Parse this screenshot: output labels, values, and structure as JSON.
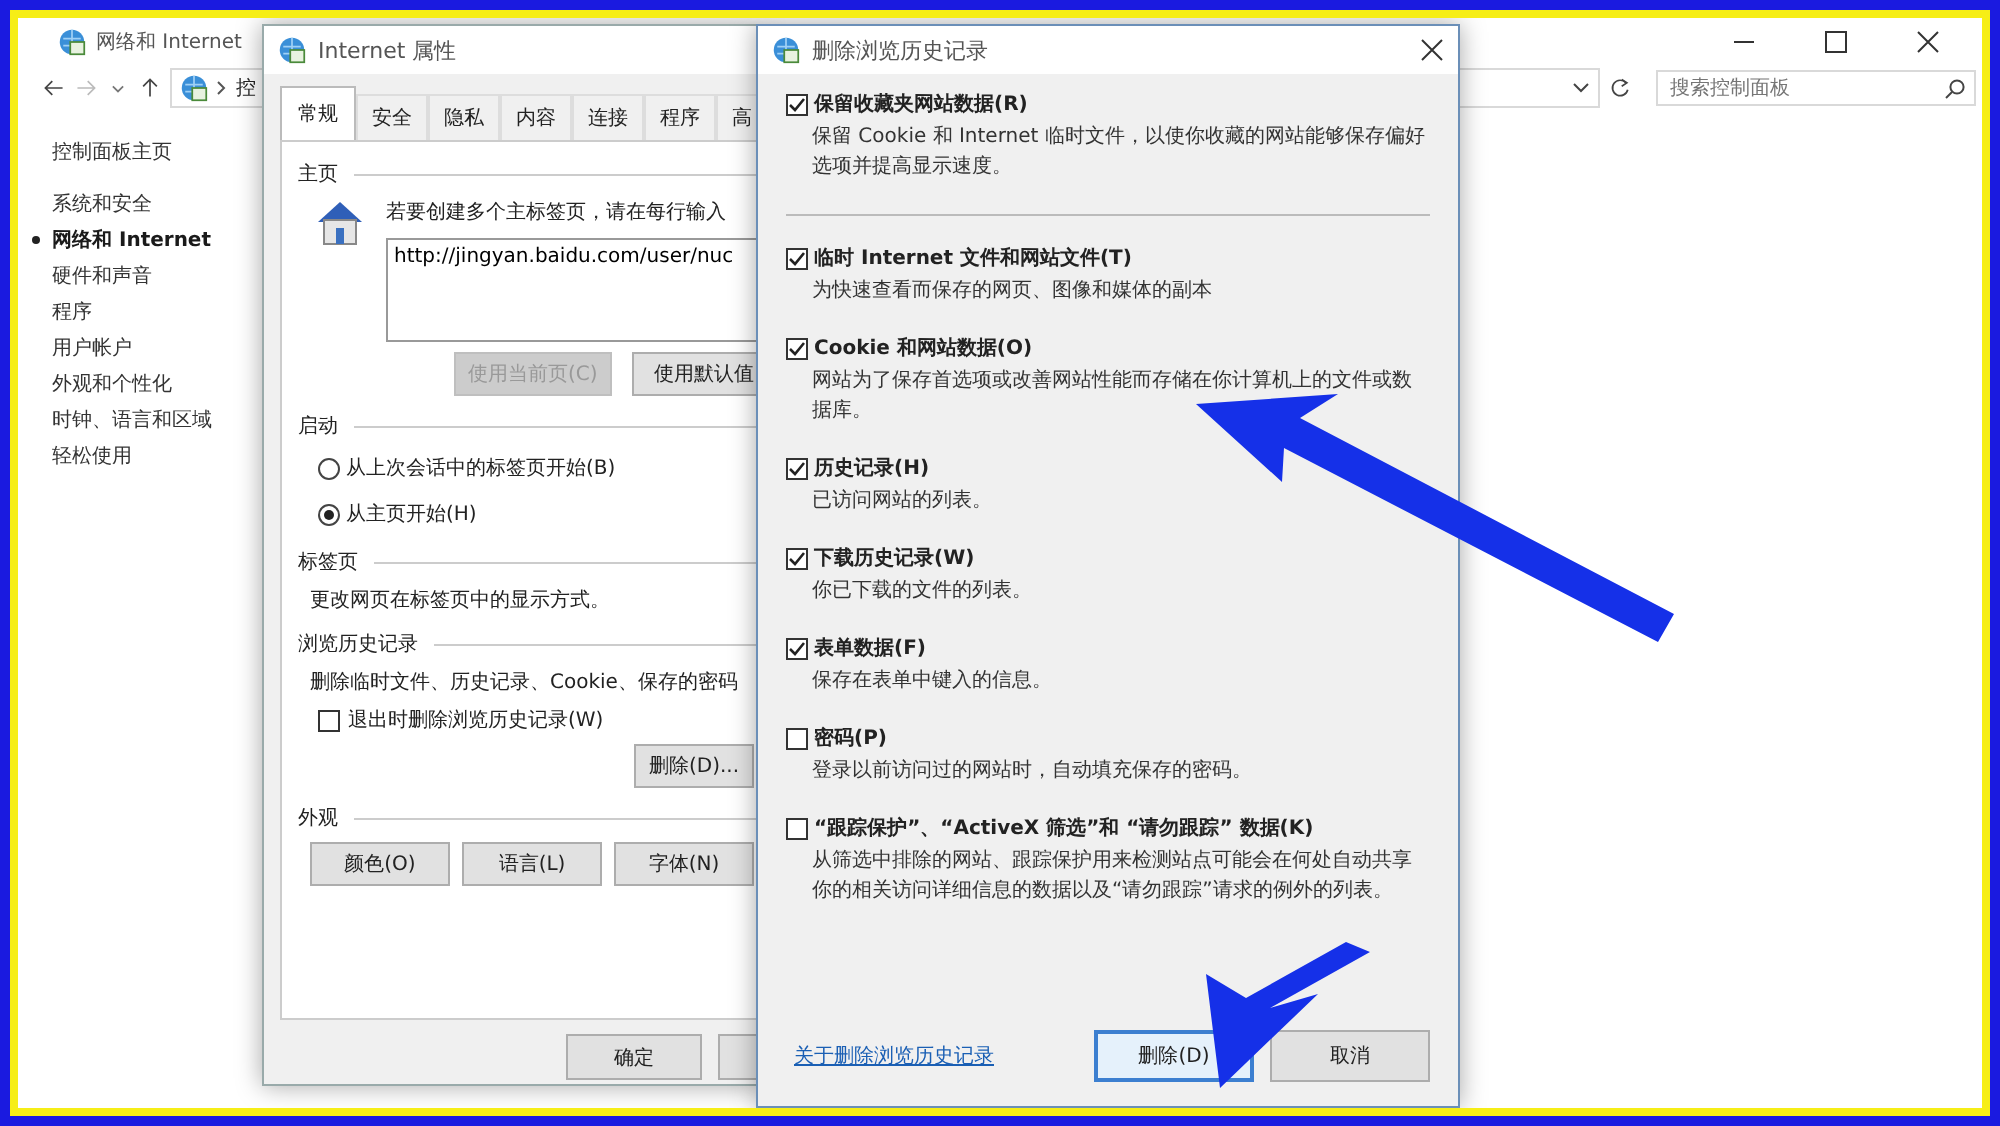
{
  "control_panel": {
    "title": "网络和 Internet",
    "breadcrumb": "控",
    "search": {
      "placeholder": "搜索控制面板"
    },
    "sidebar": [
      {
        "label": "控制面板主页",
        "selected": false
      },
      {
        "label": "系统和安全",
        "selected": false
      },
      {
        "label": "网络和 Internet",
        "selected": true
      },
      {
        "label": "硬件和声音",
        "selected": false
      },
      {
        "label": "程序",
        "selected": false
      },
      {
        "label": "用户帐户",
        "selected": false
      },
      {
        "label": "外观和个性化",
        "selected": false
      },
      {
        "label": "时钟、语言和区域",
        "selected": false
      },
      {
        "label": "轻松使用",
        "selected": false
      }
    ]
  },
  "properties_window": {
    "title": "Internet 属性",
    "tabs": [
      {
        "label": "常规",
        "selected": true
      },
      {
        "label": "安全",
        "selected": false
      },
      {
        "label": "隐私",
        "selected": false
      },
      {
        "label": "内容",
        "selected": false
      },
      {
        "label": "连接",
        "selected": false
      },
      {
        "label": "程序",
        "selected": false
      },
      {
        "label": "高",
        "selected": false
      }
    ],
    "home": {
      "heading": "主页",
      "hint": "若要创建多个主标签页，请在每行输入",
      "value": "http://jingyan.baidu.com/user/nuc",
      "buttons": [
        {
          "label": "使用当前页(C)",
          "disabled": true
        },
        {
          "label": "使用默认值",
          "disabled": false
        }
      ]
    },
    "startup": {
      "heading": "启动",
      "options": [
        {
          "label": "从上次会话中的标签页开始(B)",
          "selected": false
        },
        {
          "label": "从主页开始(H)",
          "selected": true
        }
      ]
    },
    "tabs_section": {
      "heading": "标签页",
      "text": "更改网页在标签页中的显示方式。"
    },
    "history": {
      "heading": "浏览历史记录",
      "text": "删除临时文件、历史记录、Cookie、保存的密码",
      "exit_option": {
        "label": "退出时删除浏览历史记录(W)",
        "checked": false
      },
      "delete_button": "删除(D)..."
    },
    "appearance": {
      "heading": "外观",
      "buttons": [
        "颜色(O)",
        "语言(L)",
        "字体(N)"
      ]
    },
    "ok_button": "确定"
  },
  "dialog": {
    "title": "删除浏览历史记录",
    "keep_option": {
      "label": "保留收藏夹网站数据(R)",
      "description": "保留 Cookie 和 Internet 临时文件，以使你收藏的网站能够保存偏好选项并提高显示速度。",
      "checked": true
    },
    "options": [
      {
        "label": "临时 Internet 文件和网站文件(T)",
        "description": "为快速查看而保存的网页、图像和媒体的副本",
        "checked": true
      },
      {
        "label": "Cookie 和网站数据(O)",
        "description": "网站为了保存首选项或改善网站性能而存储在你计算机上的文件或数据库。",
        "checked": true
      },
      {
        "label": "历史记录(H)",
        "description": "已访问网站的列表。",
        "checked": true
      },
      {
        "label": "下载历史记录(W)",
        "description": "你已下载的文件的列表。",
        "checked": true
      },
      {
        "label": "表单数据(F)",
        "description": "保存在表单中键入的信息。",
        "checked": true
      },
      {
        "label": "密码(P)",
        "description": "登录以前访问过的网站时，自动填充保存的密码。",
        "checked": false
      },
      {
        "label": "“跟踪保护”、“ActiveX 筛选”和 “请勿跟踪” 数据(K)",
        "description": "从筛选中排除的网站、跟踪保护用来检测站点可能会在何处自动共享你的相关访问详细信息的数据以及“请勿跟踪”请求的例外的列表。",
        "checked": false
      }
    ],
    "link": "关于删除浏览历史记录",
    "buttons": [
      {
        "label": "删除(D)",
        "focused": true
      },
      {
        "label": "取消",
        "focused": false
      }
    ]
  }
}
